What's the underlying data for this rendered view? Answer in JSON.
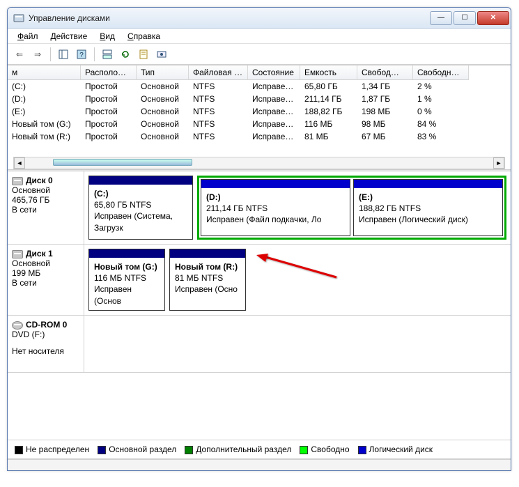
{
  "title": "Управление дисками",
  "menu": [
    "Файл",
    "Действие",
    "Вид",
    "Справка"
  ],
  "columns": [
    "м",
    "Располо…",
    "Тип",
    "Файловая с…",
    "Состояние",
    "Емкость",
    "Свобод…",
    "Свободно %"
  ],
  "rows": [
    {
      "name": "(C:)",
      "layout": "Простой",
      "type": "Основной",
      "fs": "NTFS",
      "state": "Исправен…",
      "cap": "65,80 ГБ",
      "free": "1,34 ГБ",
      "pct": "2 %"
    },
    {
      "name": "(D:)",
      "layout": "Простой",
      "type": "Основной",
      "fs": "NTFS",
      "state": "Исправен…",
      "cap": "211,14 ГБ",
      "free": "1,87 ГБ",
      "pct": "1 %"
    },
    {
      "name": "(E:)",
      "layout": "Простой",
      "type": "Основной",
      "fs": "NTFS",
      "state": "Исправен…",
      "cap": "188,82 ГБ",
      "free": "198 МБ",
      "pct": "0 %"
    },
    {
      "name": "Новый том (G:)",
      "layout": "Простой",
      "type": "Основной",
      "fs": "NTFS",
      "state": "Исправен…",
      "cap": "116 МБ",
      "free": "98 МБ",
      "pct": "84 %"
    },
    {
      "name": "Новый том (R:)",
      "layout": "Простой",
      "type": "Основной",
      "fs": "NTFS",
      "state": "Исправен…",
      "cap": "81 МБ",
      "free": "67 МБ",
      "pct": "83 %"
    }
  ],
  "disks": {
    "d0": {
      "title": "Диск 0",
      "type": "Основной",
      "size": "465,76 ГБ",
      "status": "В сети"
    },
    "d0p0": {
      "name": "(C:)",
      "l2": "65,80 ГБ NTFS",
      "l3": "Исправен (Система, Загрузк"
    },
    "d0p1": {
      "name": "(D:)",
      "l2": "211,14 ГБ NTFS",
      "l3": "Исправен (Файл подкачки, Ло"
    },
    "d0p2": {
      "name": "(E:)",
      "l2": "188,82 ГБ NTFS",
      "l3": "Исправен (Логический диск)"
    },
    "d1": {
      "title": "Диск 1",
      "type": "Основной",
      "size": "199 МБ",
      "status": "В сети"
    },
    "d1p0": {
      "name": "Новый том  (G:)",
      "l2": "116 МБ NTFS",
      "l3": "Исправен (Основ"
    },
    "d1p1": {
      "name": "Новый том  (R:)",
      "l2": "81 МБ NTFS",
      "l3": "Исправен (Осно"
    },
    "cd": {
      "title": "CD-ROM 0",
      "type": "DVD (F:)",
      "status": "Нет носителя"
    }
  },
  "legend": {
    "unalloc": "Не распределен",
    "primary": "Основной раздел",
    "extended": "Дополнительный раздел",
    "free": "Свободно",
    "logical": "Логический диск"
  },
  "legend_colors": {
    "unalloc": "#000",
    "primary": "#000080",
    "extended": "#008000",
    "free": "#00ff00",
    "logical": "#0000cc"
  }
}
